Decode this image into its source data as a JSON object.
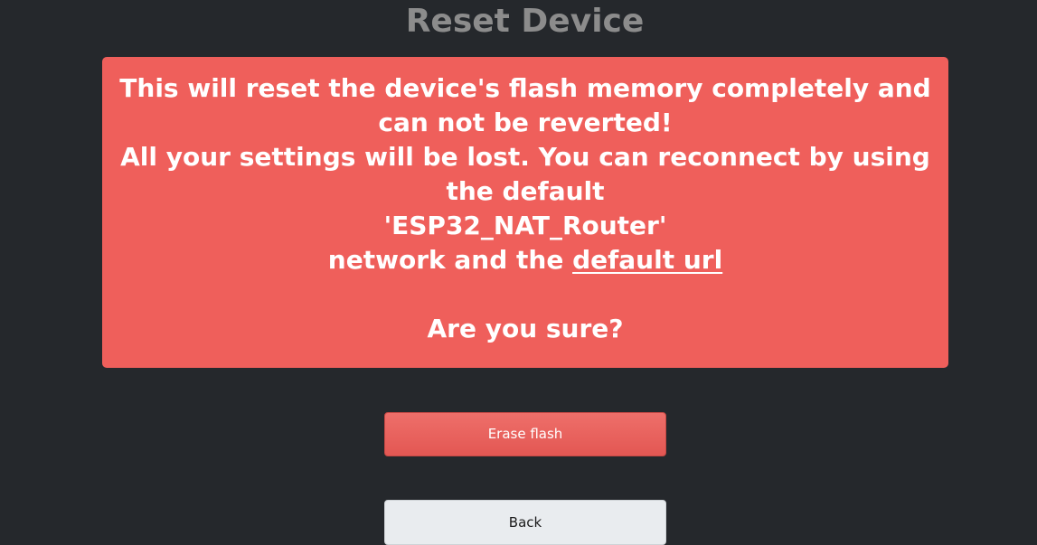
{
  "header": {
    "title": "Reset Device"
  },
  "warning": {
    "line1": "This will reset the device's flash memory completely and can not be reverted!",
    "line2": "All your settings will be lost. You can reconnect by using the default",
    "line3": "'ESP32_NAT_Router'",
    "line4_prefix": "network and the ",
    "link_text": "default url",
    "question": "Are you sure?"
  },
  "actions": {
    "erase_label": "Erase flash",
    "back_label": "Back"
  },
  "colors": {
    "background": "#25282c",
    "warning_box": "#ef5f5b",
    "erase_button": "#e35753",
    "back_button": "#e9ecef",
    "title_text": "#8c8c8c"
  }
}
